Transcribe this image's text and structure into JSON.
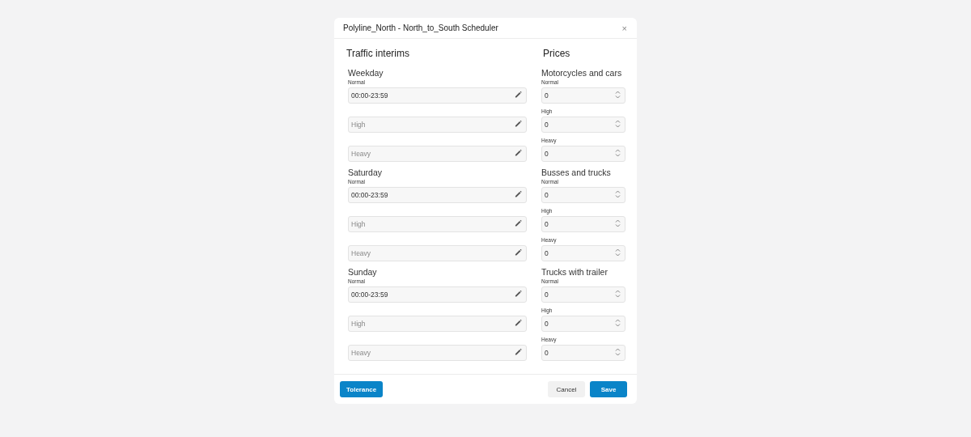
{
  "dialog": {
    "title": "Polyline_North - North_to_South Scheduler",
    "close": "×"
  },
  "traffic_interims": {
    "heading": "Traffic interims",
    "days": [
      {
        "title": "Weekday",
        "fields": [
          {
            "label": "Normal",
            "value": "00:00-23:59"
          },
          {
            "placeholder": "High"
          },
          {
            "placeholder": "Heavy"
          }
        ]
      },
      {
        "title": "Saturday",
        "fields": [
          {
            "label": "Normal",
            "value": "00:00-23:59"
          },
          {
            "placeholder": "High"
          },
          {
            "placeholder": "Heavy"
          }
        ]
      },
      {
        "title": "Sunday",
        "fields": [
          {
            "label": "Normal",
            "value": "00:00-23:59"
          },
          {
            "placeholder": "High"
          },
          {
            "placeholder": "Heavy"
          }
        ]
      }
    ]
  },
  "prices": {
    "heading": "Prices",
    "categories": [
      {
        "title": "Motorcycles and cars",
        "fields": [
          {
            "label": "Normal",
            "value": "0"
          },
          {
            "label": "High",
            "value": "0"
          },
          {
            "label": "Heavy",
            "value": "0"
          }
        ]
      },
      {
        "title": "Busses and trucks",
        "fields": [
          {
            "label": "Normal",
            "value": "0"
          },
          {
            "label": "High",
            "value": "0"
          },
          {
            "label": "Heavy",
            "value": "0"
          }
        ]
      },
      {
        "title": "Trucks with trailer",
        "fields": [
          {
            "label": "Normal",
            "value": "0"
          },
          {
            "label": "High",
            "value": "0"
          },
          {
            "label": "Heavy",
            "value": "0"
          }
        ]
      }
    ]
  },
  "footer": {
    "buttons": [
      {
        "label": "Tolerance",
        "kind": "primary"
      },
      {
        "label": "Cancel",
        "kind": "secondary"
      },
      {
        "label": "Save",
        "kind": "primary"
      }
    ]
  }
}
